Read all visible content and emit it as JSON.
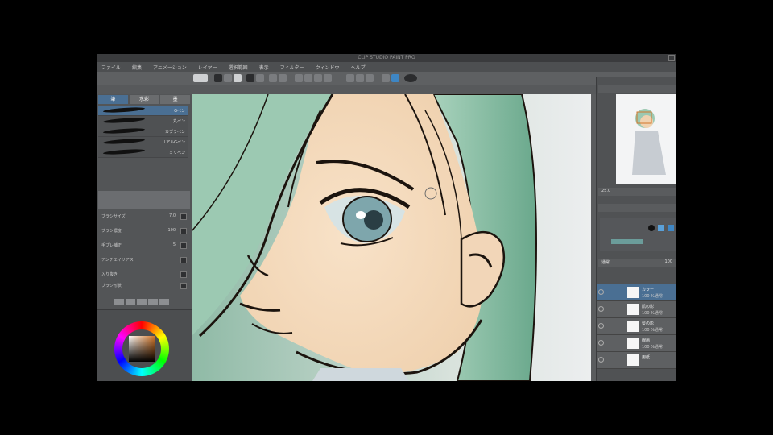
{
  "app": {
    "title": "CLIP STUDIO PAINT PRO"
  },
  "menu": {
    "items": [
      "ファイル",
      "編集",
      "アニメーション",
      "レイヤー",
      "選択範囲",
      "表示",
      "フィルター",
      "ウィンドウ",
      "ヘルプ"
    ]
  },
  "tool_property": {
    "tabs": [
      "筆",
      "水彩",
      "墨"
    ],
    "brushes": [
      {
        "name": "Gペン",
        "selected": true
      },
      {
        "name": "丸ペン",
        "selected": false
      },
      {
        "name": "カブラペン",
        "selected": false
      },
      {
        "name": "リアルGペン",
        "selected": false
      },
      {
        "name": "ミリペン",
        "selected": false
      }
    ],
    "properties": [
      {
        "label": "ブラシサイズ",
        "value": "7.0"
      },
      {
        "label": "ブラシ濃度",
        "value": "100"
      },
      {
        "label": "手ブレ補正",
        "value": "5"
      },
      {
        "label": "アンチエイリアス",
        "value": ""
      },
      {
        "label": "入り抜き",
        "value": ""
      },
      {
        "label": "ブラシ形状",
        "value": ""
      }
    ]
  },
  "colors": {
    "accent": "#4a6f93",
    "hair": "#9cc9b2",
    "skin": "#f5dcc0",
    "line": "#1c140e",
    "main_color": "#d2762a"
  },
  "layers": {
    "blend_mode": "通常",
    "opacity": "100",
    "items": [
      {
        "name": "カラー",
        "mode": "100 %通常",
        "selected": true
      },
      {
        "name": "肌の影",
        "mode": "100 %通常",
        "selected": false
      },
      {
        "name": "髪の影",
        "mode": "100 %通常",
        "selected": false
      },
      {
        "name": "線画",
        "mode": "100 %通常",
        "selected": false
      },
      {
        "name": "用紙",
        "mode": "",
        "selected": false
      }
    ]
  },
  "navigator": {
    "zoom": "25.0"
  }
}
